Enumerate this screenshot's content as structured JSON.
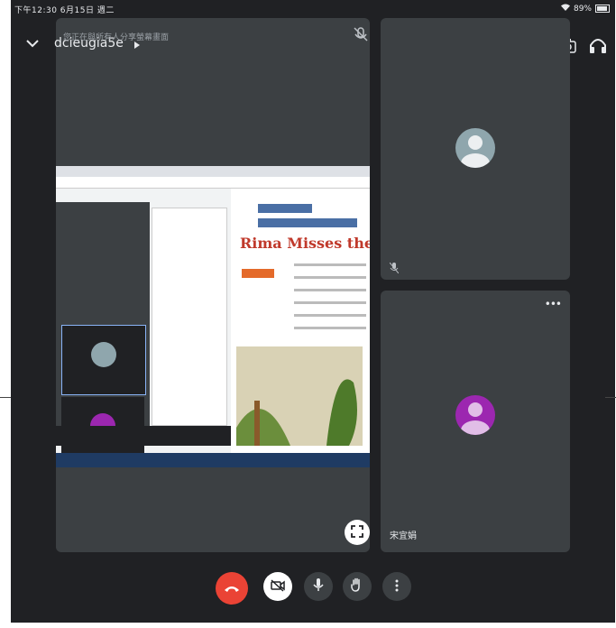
{
  "status_bar": {
    "time_date": "下午12:30  6月15日 週二",
    "battery": "89%"
  },
  "meeting": {
    "code": "dcieugia5e",
    "share_notice": "您正在與所有人分享螢幕畫面"
  },
  "shared_content": {
    "doc_title": "Rima Misses the Rainforest"
  },
  "tiles": [
    {
      "name": "",
      "avatar_color": "#8fa6ad",
      "muted": true
    },
    {
      "name": "宋宜娟",
      "avatar_color": "#9c27b0",
      "muted": false
    }
  ],
  "icons": {
    "expand": "chevron-down-icon",
    "mic_off": "mic-off-icon",
    "camera_switch": "camera-switch-icon",
    "audio": "headphones-icon",
    "fullscreen": "fullscreen-icon",
    "hangup": "hangup-icon",
    "camera_off": "camera-off-icon",
    "mic": "mic-icon",
    "raise_hand": "hand-icon",
    "more": "more-vert-icon"
  },
  "colors": {
    "background": "#202124",
    "tile": "#3c4043",
    "hangup": "#ea4335"
  }
}
